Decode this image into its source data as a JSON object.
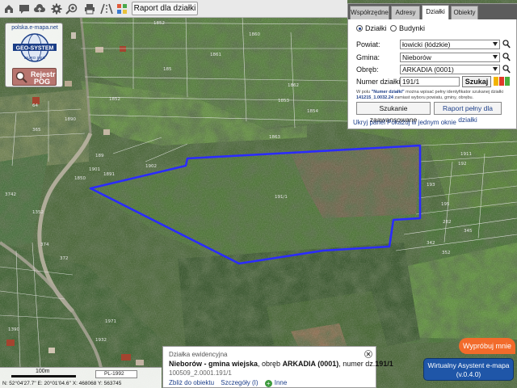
{
  "toolbar": {
    "icons": [
      "home-icon",
      "chat-icon",
      "cloud-icon",
      "gear-icon",
      "street-view-icon",
      "print-icon",
      "road-icon",
      "grid-icon"
    ],
    "raport_label": "Raport dla działki"
  },
  "logo": {
    "site": "polska.e-mapa.net",
    "brand": "GEO-SYSTEM",
    "sub": "BIURO SIEĆ",
    "rejestr_line1": "Rejestr",
    "rejestr_line2": "POG"
  },
  "panel": {
    "tabs": [
      {
        "label": "Współrzędne",
        "active": false
      },
      {
        "label": "Adresy",
        "active": false
      },
      {
        "label": "Działki",
        "active": true
      },
      {
        "label": "Obiekty",
        "active": false
      }
    ],
    "radio_dzialki": "Działki",
    "radio_budynki": "Budynki",
    "selected_radio": "Działki",
    "powiat_label": "Powiat:",
    "powiat_value": "łowicki (łódzkie)",
    "gmina_label": "Gmina:",
    "gmina_value": "Nieborów",
    "obreb_label": "Obręb:",
    "obreb_value": "ARKADIA (0001)",
    "numer_label": "Numer działki:",
    "numer_value": "191/1",
    "szukaj_label": "Szukaj",
    "help_prefix": "W polu",
    "help_quote": "\"Numer działki\"",
    "help_text1": "można wpisać pełny identyfikator szukanej działki",
    "help_example": "141215_1.0032.24",
    "help_text2": "zamiast wyboru powiatu, gminy, obrębu.",
    "adv_label": "Szukanie zaawansowane",
    "raport_label": "Raport pełny dla działki",
    "hide_label": "Ukryj panel",
    "show_window_label": "Pokazuj w jednym oknie",
    "status_colors": [
      "#f2b400",
      "#e03a2a",
      "#4cae3b"
    ]
  },
  "info": {
    "title": "Działka ewidencyjna",
    "gmina": "Nieborów - gmina wiejska",
    "obreb_prefix": ", obręb ",
    "obreb": "ARKADIA (0001)",
    "numer_prefix": ", numer dz.",
    "numer": "191/1",
    "id": "100509_2.0001.191/1",
    "link_zoom": "Zbliż do obiektu",
    "link_details": "Szczegóły (I)",
    "link_more": "Inne"
  },
  "scale": {
    "label": "100m",
    "crs": "PL-1992",
    "coords": "N: 52°04'27.7''  E: 20°01'04.6''  X: 468068   Y: 563745"
  },
  "assistant": {
    "try_label": "Wypróbuj mnie",
    "line1": "Wirtualny Asystent e-mapa",
    "line2": "(v.0.4.0)"
  },
  "map": {
    "parcel_outline_color": "#2b2bff",
    "boundary_color": "#f0f0f0",
    "parcel_labels": [
      "1852",
      "185",
      "1852",
      "1862",
      "1853",
      "1854",
      "1860",
      "1861",
      "1863",
      "64",
      "365",
      "1850",
      "1901",
      "1902",
      "189",
      "1890",
      "1891",
      "191/1",
      "1911",
      "192",
      "193",
      "195",
      "282",
      "342",
      "345",
      "352",
      "372",
      "374",
      "1352",
      "3742",
      "1390",
      "1932",
      "1971"
    ]
  }
}
